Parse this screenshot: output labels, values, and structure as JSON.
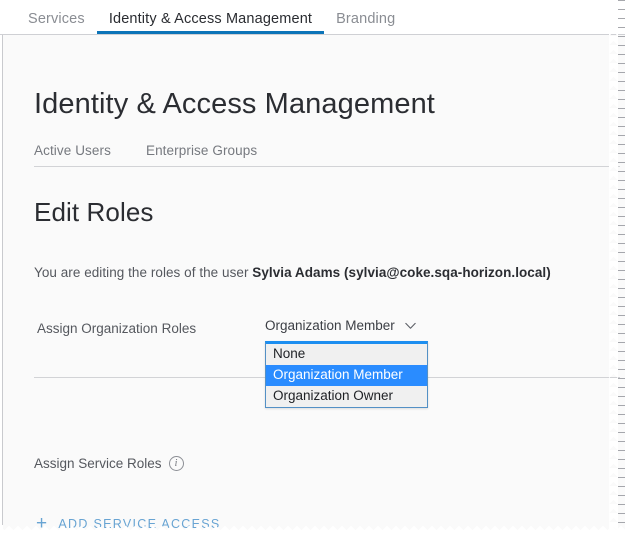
{
  "window": {
    "title": "Identity & Access Management",
    "accent_blue": "#0c74b8",
    "highlight_blue": "#2a8cff",
    "link_blue": "#68a4d3",
    "content_bg": "#fafafa"
  },
  "top_tabs": [
    {
      "label": "Services",
      "active": false
    },
    {
      "label": "Identity & Access Management",
      "active": true
    },
    {
      "label": "Branding",
      "active": false
    }
  ],
  "page": {
    "title": "Identity & Access Management",
    "subtabs": [
      {
        "label": "Active Users",
        "active": true
      },
      {
        "label": "Enterprise Groups",
        "active": false
      }
    ],
    "section_title": "Edit Roles",
    "editing_prefix": "You are editing the roles of the user ",
    "editing_user": "Sylvia Adams (sylvia@coke.sqa-horizon.local)"
  },
  "org_roles": {
    "label": "Assign Organization Roles",
    "selected": "Organization Member",
    "chevron_icon": "chevron-down-icon",
    "expanded": true,
    "options": [
      {
        "label": "None",
        "selected": false
      },
      {
        "label": "Organization Member",
        "selected": true
      },
      {
        "label": "Organization Owner",
        "selected": false
      }
    ]
  },
  "service_roles": {
    "label": "Assign Service Roles",
    "info_icon": "info-icon",
    "info_glyph": "i",
    "add_label": "ADD SERVICE ACCESS",
    "add_icon": "plus-icon",
    "add_glyph": "+"
  }
}
